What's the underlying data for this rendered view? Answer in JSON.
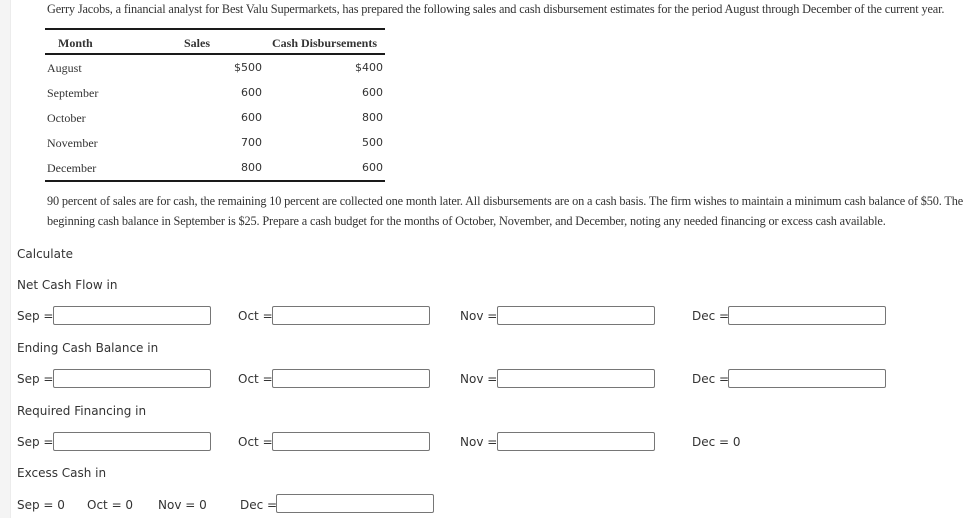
{
  "problem": {
    "intro": "Gerry Jacobs, a financial analyst for Best Valu Supermarkets, has prepared the following sales and cash disbursement estimates for the period August through December of the current year.",
    "table": {
      "headers": [
        "Month",
        "Sales",
        "Cash Disbursements"
      ],
      "rows": [
        {
          "month": "August",
          "sales": "$500",
          "disbursements": "$400"
        },
        {
          "month": "September",
          "sales": "600",
          "disbursements": "600"
        },
        {
          "month": "October",
          "sales": "600",
          "disbursements": "800"
        },
        {
          "month": "November",
          "sales": "700",
          "disbursements": "500"
        },
        {
          "month": "December",
          "sales": "800",
          "disbursements": "600"
        }
      ]
    },
    "paragraph_line1": "90 percent of sales are for cash, the remaining 10 percent are collected one month later. All disbursements are on a cash basis. The firm wishes to maintain a minimum cash balance of $50. The",
    "paragraph_line2": "beginning cash balance in September is $25. Prepare a cash budget for the months of October, November, and December, noting any needed financing or excess cash available."
  },
  "calculate": {
    "heading": "Calculate",
    "sections": [
      {
        "title": "Net Cash Flow in",
        "fields": [
          {
            "label": "Sep =",
            "value": "",
            "type": "input"
          },
          {
            "label": "Oct =",
            "value": "",
            "type": "input"
          },
          {
            "label": "Nov =",
            "value": "",
            "type": "input"
          },
          {
            "label": "Dec =",
            "value": "",
            "type": "input"
          }
        ]
      },
      {
        "title": "Ending Cash Balance in",
        "fields": [
          {
            "label": "Sep =",
            "value": "",
            "type": "input"
          },
          {
            "label": "Oct =",
            "value": "",
            "type": "input"
          },
          {
            "label": "Nov =",
            "value": "",
            "type": "input"
          },
          {
            "label": "Dec =",
            "value": "",
            "type": "input"
          }
        ]
      },
      {
        "title": "Required Financing in",
        "fields": [
          {
            "label": "Sep =",
            "value": "",
            "type": "input"
          },
          {
            "label": "Oct =",
            "value": "",
            "type": "input"
          },
          {
            "label": "Nov =",
            "value": "",
            "type": "input"
          },
          {
            "label": "Dec = 0",
            "type": "text"
          }
        ]
      },
      {
        "title": "Excess Cash in",
        "fields": [
          {
            "label": "Sep = 0",
            "type": "text"
          },
          {
            "label": "Oct = 0",
            "type": "text"
          },
          {
            "label": "Nov = 0",
            "type": "text"
          },
          {
            "label": "Dec =",
            "value": "",
            "type": "input"
          }
        ]
      }
    ]
  }
}
